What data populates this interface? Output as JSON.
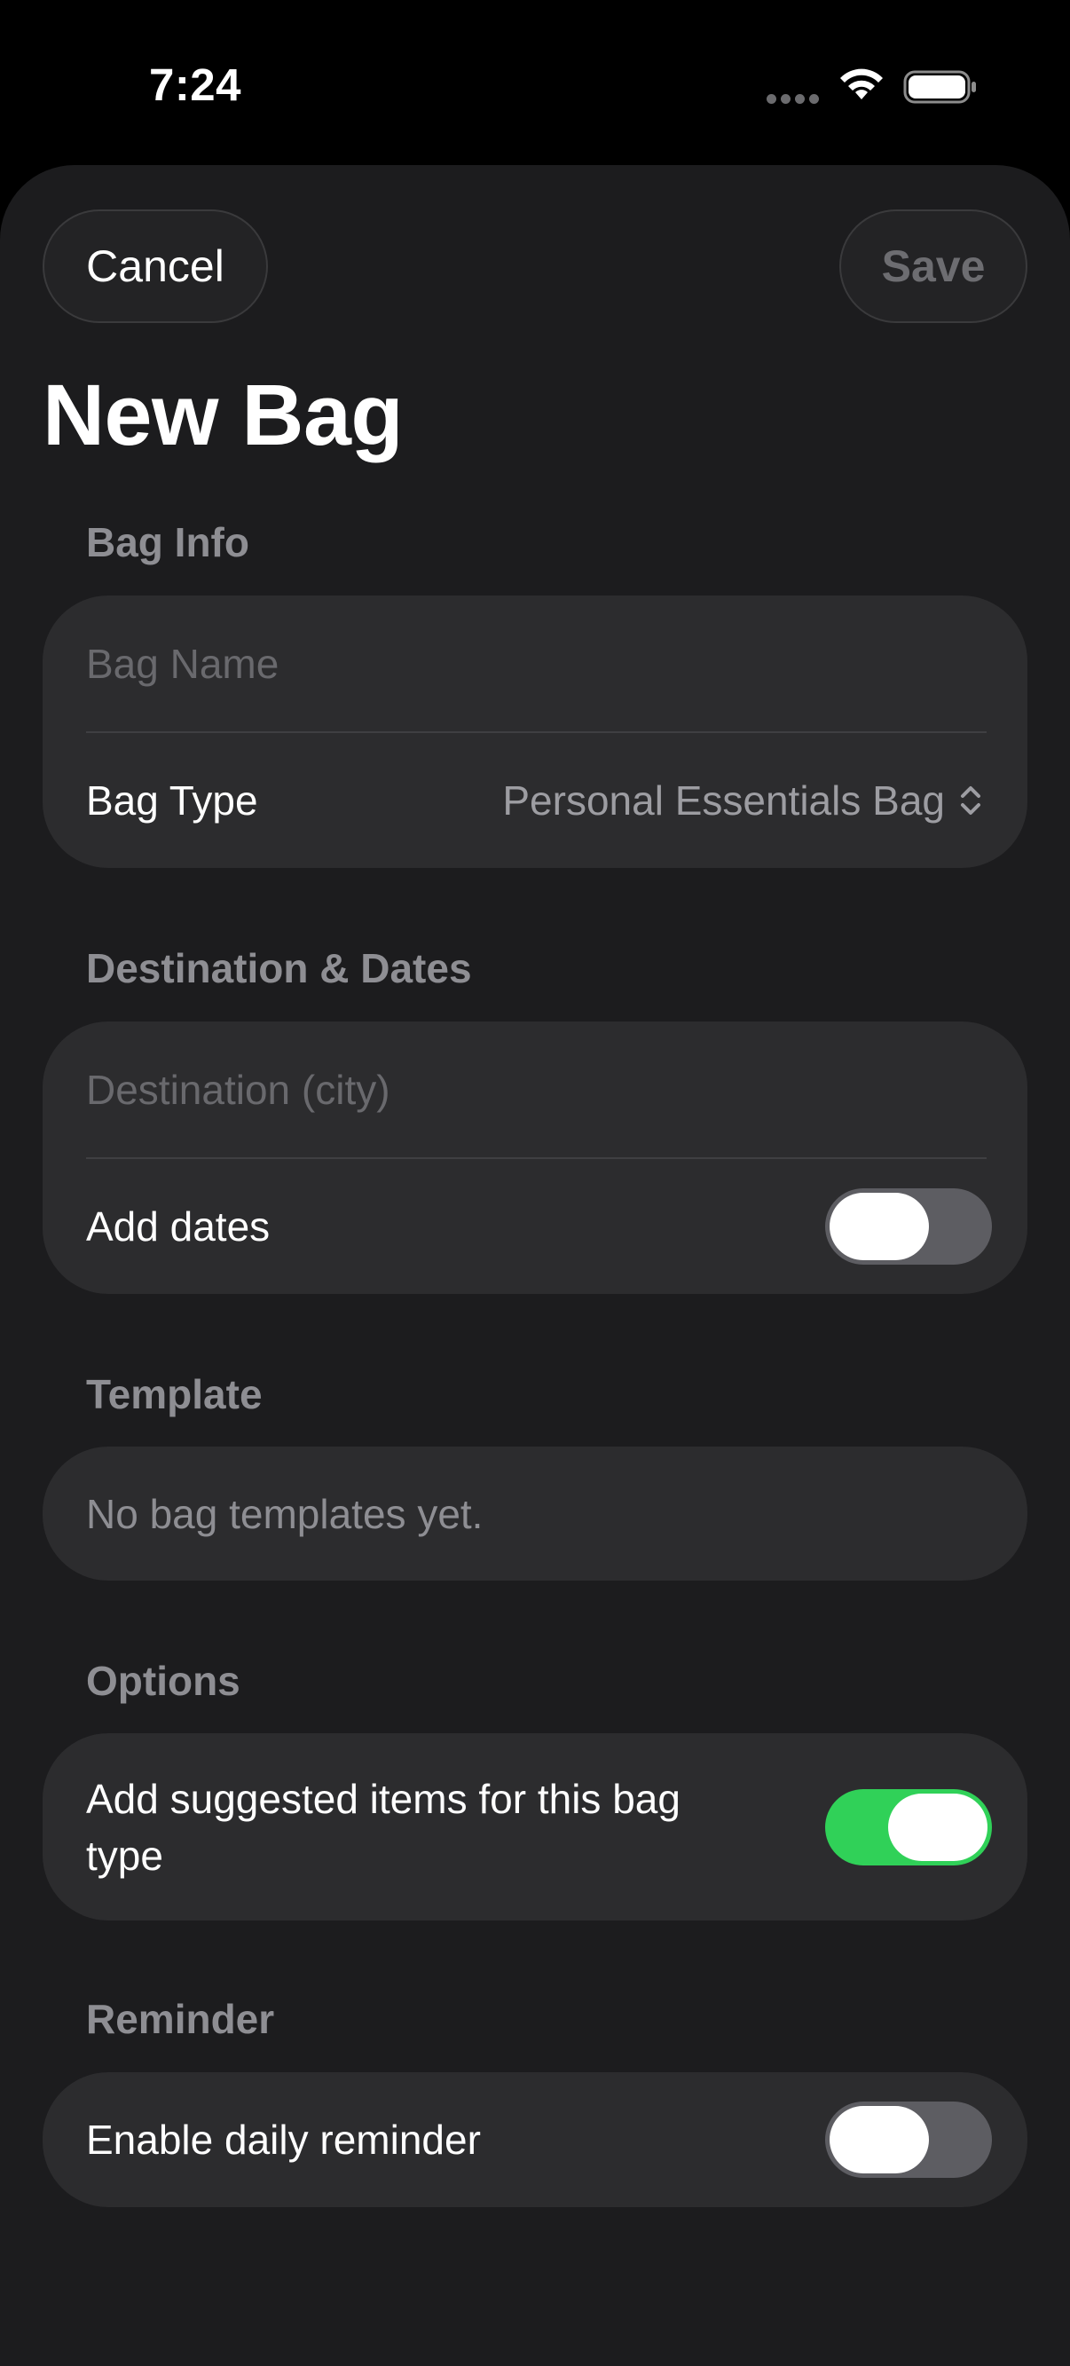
{
  "status_bar": {
    "time": "7:24"
  },
  "header": {
    "cancel_label": "Cancel",
    "save_label": "Save",
    "title": "New Bag"
  },
  "sections": {
    "bag_info": {
      "header": "Bag Info",
      "name_placeholder": "Bag Name",
      "name_value": "",
      "type_label": "Bag Type",
      "type_value": "Personal Essentials Bag"
    },
    "destination": {
      "header": "Destination & Dates",
      "destination_placeholder": "Destination (city)",
      "destination_value": "",
      "add_dates_label": "Add dates",
      "add_dates_on": false
    },
    "template": {
      "header": "Template",
      "empty_text": "No bag templates yet."
    },
    "options": {
      "header": "Options",
      "suggested_label": "Add suggested items for this bag type",
      "suggested_on": true
    },
    "reminder": {
      "header": "Reminder",
      "daily_label": "Enable daily reminder",
      "daily_on": false
    }
  },
  "colors": {
    "background": "#1c1c1e",
    "card": "#2c2c2e",
    "toggle_on": "#30d158",
    "toggle_off": "#5d5d62"
  },
  "icons": [
    "signal-dots-icon",
    "wifi-icon",
    "battery-icon",
    "chevron-updown-icon"
  ]
}
